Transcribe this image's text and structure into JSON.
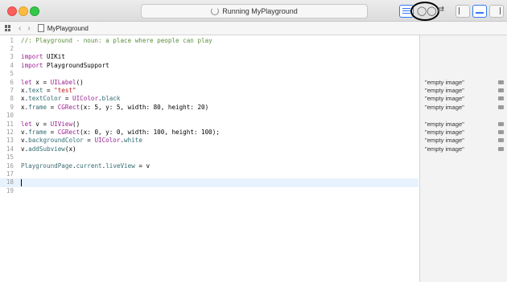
{
  "window": {
    "status_text": "Running MyPlayground"
  },
  "pathbar": {
    "file_name": "MyPlayground"
  },
  "code": {
    "lines": [
      {
        "n": "1",
        "tokens": [
          {
            "t": "//: Playground - noun: a place where people can play",
            "c": "cmt"
          }
        ]
      },
      {
        "n": "2",
        "tokens": []
      },
      {
        "n": "3",
        "tokens": [
          {
            "t": "import ",
            "c": "kw"
          },
          {
            "t": "UIKit",
            "c": "pl"
          }
        ]
      },
      {
        "n": "4",
        "tokens": [
          {
            "t": "import ",
            "c": "kw"
          },
          {
            "t": "PlaygroundSupport",
            "c": "pl"
          }
        ]
      },
      {
        "n": "5",
        "tokens": []
      },
      {
        "n": "6",
        "tokens": [
          {
            "t": "let ",
            "c": "kw"
          },
          {
            "t": "x = ",
            "c": "pl"
          },
          {
            "t": "UILabel",
            "c": "kw"
          },
          {
            "t": "()",
            "c": "pl"
          }
        ]
      },
      {
        "n": "7",
        "tokens": [
          {
            "t": "x.",
            "c": "pl"
          },
          {
            "t": "text",
            "c": "prop"
          },
          {
            "t": " = ",
            "c": "pl"
          },
          {
            "t": "\"test\"",
            "c": "str"
          }
        ]
      },
      {
        "n": "8",
        "tokens": [
          {
            "t": "x.",
            "c": "pl"
          },
          {
            "t": "textColor",
            "c": "prop"
          },
          {
            "t": " = ",
            "c": "pl"
          },
          {
            "t": "UIColor",
            "c": "kw"
          },
          {
            "t": ".",
            "c": "pl"
          },
          {
            "t": "black",
            "c": "prop"
          }
        ]
      },
      {
        "n": "9",
        "tokens": [
          {
            "t": "x.",
            "c": "pl"
          },
          {
            "t": "frame",
            "c": "prop"
          },
          {
            "t": " = ",
            "c": "pl"
          },
          {
            "t": "CGRect",
            "c": "kw"
          },
          {
            "t": "(x: 5, y: 5, width: 80, height: 20)",
            "c": "pl"
          }
        ]
      },
      {
        "n": "10",
        "tokens": []
      },
      {
        "n": "11",
        "tokens": [
          {
            "t": "let ",
            "c": "kw"
          },
          {
            "t": "v = ",
            "c": "pl"
          },
          {
            "t": "UIView",
            "c": "kw"
          },
          {
            "t": "()",
            "c": "pl"
          }
        ]
      },
      {
        "n": "12",
        "tokens": [
          {
            "t": "v.",
            "c": "pl"
          },
          {
            "t": "frame",
            "c": "prop"
          },
          {
            "t": " = ",
            "c": "pl"
          },
          {
            "t": "CGRect",
            "c": "kw"
          },
          {
            "t": "(x: 0, y: 0, width: 100, height: 100);",
            "c": "pl"
          }
        ]
      },
      {
        "n": "13",
        "tokens": [
          {
            "t": "v.",
            "c": "pl"
          },
          {
            "t": "backgroundColor",
            "c": "prop"
          },
          {
            "t": " = ",
            "c": "pl"
          },
          {
            "t": "UIColor",
            "c": "kw"
          },
          {
            "t": ".",
            "c": "pl"
          },
          {
            "t": "white",
            "c": "prop"
          }
        ]
      },
      {
        "n": "14",
        "tokens": [
          {
            "t": "v.",
            "c": "pl"
          },
          {
            "t": "addSubview",
            "c": "prop"
          },
          {
            "t": "(x)",
            "c": "pl"
          }
        ]
      },
      {
        "n": "15",
        "tokens": []
      },
      {
        "n": "16",
        "tokens": [
          {
            "t": "PlaygroundPage",
            "c": "cls"
          },
          {
            "t": ".",
            "c": "pl"
          },
          {
            "t": "current",
            "c": "prop"
          },
          {
            "t": ".",
            "c": "pl"
          },
          {
            "t": "liveView",
            "c": "prop"
          },
          {
            "t": " = v",
            "c": "pl"
          }
        ]
      },
      {
        "n": "17",
        "tokens": []
      },
      {
        "n": "18",
        "tokens": [],
        "current": true
      },
      {
        "n": "19",
        "tokens": []
      }
    ]
  },
  "results": [
    {
      "line": 6,
      "text": "\"empty image\""
    },
    {
      "line": 7,
      "text": "\"empty image\""
    },
    {
      "line": 8,
      "text": "\"empty image\""
    },
    {
      "line": 9,
      "text": "\"empty image\""
    },
    {
      "line": 11,
      "text": "\"empty image\""
    },
    {
      "line": 12,
      "text": "\"empty image\""
    },
    {
      "line": 13,
      "text": "\"empty image\""
    },
    {
      "line": 14,
      "text": "\"empty image\""
    }
  ],
  "icons": {
    "status": "spinner-icon",
    "assistant": "assistant-editor-icon",
    "version": "version-editor-icon",
    "quicklook": "quick-look-icon"
  }
}
